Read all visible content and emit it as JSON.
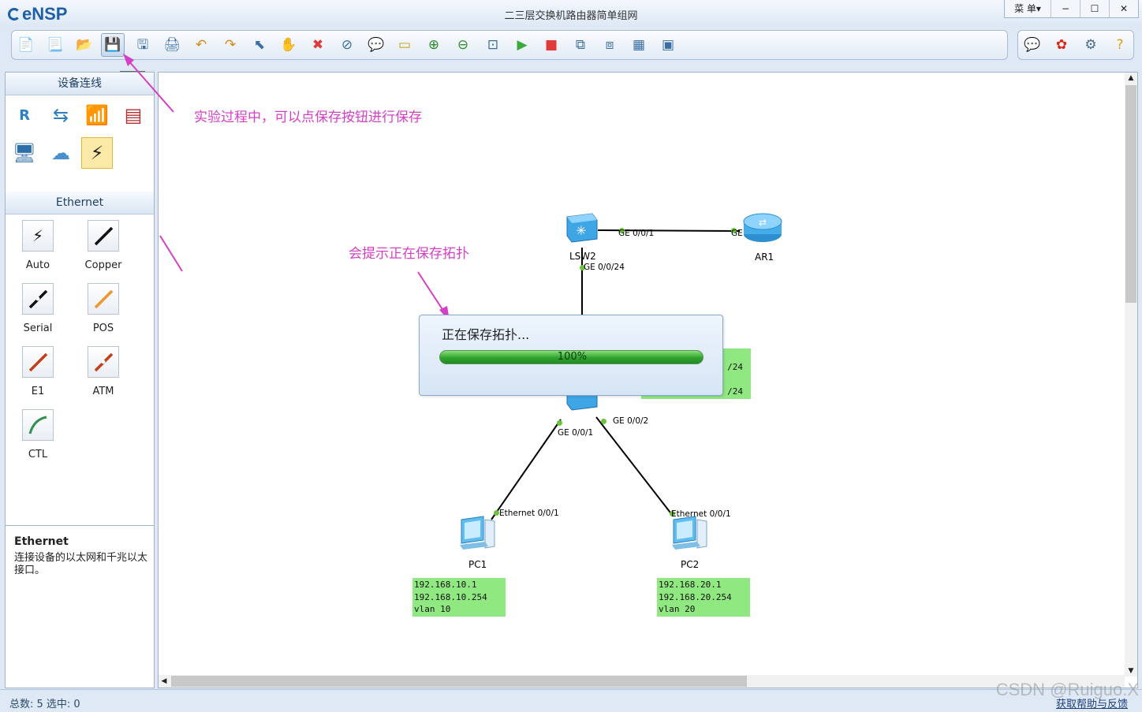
{
  "app": {
    "name": "eNSP",
    "title": "二三层交换机路由器简单组网",
    "menu_label": "菜 单▾"
  },
  "window_controls": {
    "minimize": "−",
    "maximize": "☐",
    "close": "✕"
  },
  "toolbar": {
    "save_tooltip": "保存",
    "buttons": [
      {
        "name": "new-topology",
        "icon": "📄"
      },
      {
        "name": "new-from-template",
        "icon": "📃"
      },
      {
        "name": "open-topology",
        "icon": "📂"
      },
      {
        "name": "save",
        "icon": "💾"
      },
      {
        "name": "save-as",
        "icon": "🖫"
      },
      {
        "name": "print",
        "icon": "🖨"
      },
      {
        "name": "undo",
        "icon": "↶"
      },
      {
        "name": "redo",
        "icon": "↷"
      },
      {
        "name": "select",
        "icon": "⬉"
      },
      {
        "name": "pan",
        "icon": "✋"
      },
      {
        "name": "delete",
        "icon": "✖"
      },
      {
        "name": "delete-all-links",
        "icon": "⊘"
      },
      {
        "name": "add-text",
        "icon": "💬"
      },
      {
        "name": "palette",
        "icon": "▭"
      },
      {
        "name": "zoom-in",
        "icon": "⊕"
      },
      {
        "name": "zoom-out",
        "icon": "⊖"
      },
      {
        "name": "reset-view",
        "icon": "⊡"
      },
      {
        "name": "start-devices",
        "icon": "▶"
      },
      {
        "name": "stop-devices",
        "icon": "■"
      },
      {
        "name": "capture",
        "icon": "⧉"
      },
      {
        "name": "topology-view",
        "icon": "⧈"
      },
      {
        "name": "grid",
        "icon": "▦"
      },
      {
        "name": "console",
        "icon": "▣"
      }
    ],
    "right_buttons": [
      {
        "name": "feedback",
        "icon": "💬"
      },
      {
        "name": "huawei",
        "icon": "✿"
      },
      {
        "name": "settings",
        "icon": "⚙"
      },
      {
        "name": "help",
        "icon": "?"
      }
    ]
  },
  "left_panel": {
    "header": "设备连线",
    "devices": [
      {
        "name": "router",
        "icon": "R"
      },
      {
        "name": "switch",
        "icon": "⇆"
      },
      {
        "name": "wireless",
        "icon": "📶"
      },
      {
        "name": "firewall",
        "icon": "▤"
      },
      {
        "name": "terminal",
        "icon": "🖥"
      },
      {
        "name": "cloud",
        "icon": "☁"
      },
      {
        "name": "cable",
        "icon": "⚡"
      }
    ],
    "cable_header": "Ethernet",
    "cables": [
      {
        "label": "Auto",
        "color": "#111111"
      },
      {
        "label": "Copper",
        "color": "#111111"
      },
      {
        "label": "Serial",
        "color": "#111111"
      },
      {
        "label": "POS",
        "color": "#f0962f"
      },
      {
        "label": "E1",
        "color": "#c0401a"
      },
      {
        "label": "ATM",
        "color": "#c0401a"
      },
      {
        "label": "CTL",
        "color": "#2f8f4f"
      }
    ]
  },
  "info": {
    "title": "Ethernet",
    "desc": "连接设备的以太网和千兆以太接口。"
  },
  "annotations": {
    "save_hint": "实验过程中，可以点保存按钮进行保存",
    "saving_hint": "会提示正在保存拓扑"
  },
  "topology": {
    "lsw2": {
      "label": "LSW2",
      "if_to_ar1": "GE 0/0/1",
      "if_down": "GE 0/0/24"
    },
    "ar1": {
      "label": "AR1",
      "if": "GE 0/0/0"
    },
    "lsw1": {
      "if1": "GE 0/0/1",
      "if2": "GE 0/0/2",
      "ip_tail_1": "/24",
      "ip_tail_2": "/24"
    },
    "pc1": {
      "label": "PC1",
      "if": "Ethernet 0/0/1",
      "ip": "192.168.10.1",
      "gw": "192.168.10.254",
      "vlan": "vlan 10"
    },
    "pc2": {
      "label": "PC2",
      "if": "Ethernet 0/0/1",
      "ip": "192.168.20.1",
      "gw": "192.168.20.254",
      "vlan": "vlan 20"
    }
  },
  "dialog": {
    "text": "正在保存拓扑...",
    "progress_label": "100%",
    "progress": 1.0
  },
  "status": {
    "text": "总数: 5  选中: 0",
    "help_link": "获取帮助与反馈"
  },
  "watermark": "CSDN @Ruiguo.X",
  "colors": {
    "annotation": "#d43fc6",
    "ip_box": "#90e880",
    "progress": "#2fa32e",
    "link_dot": "#6cc43a"
  }
}
